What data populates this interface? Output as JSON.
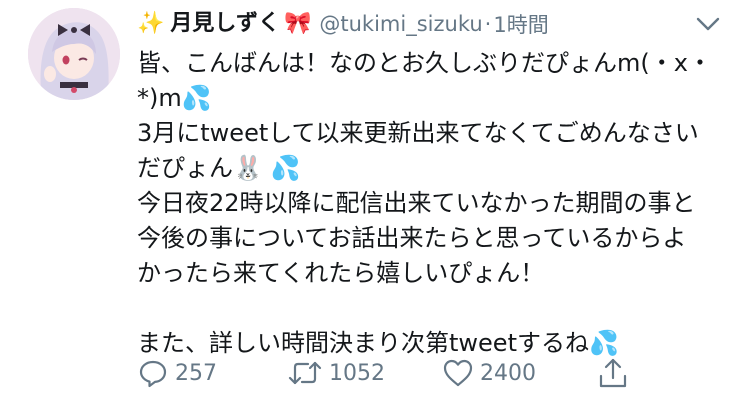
{
  "author": {
    "name_prefix": "✨",
    "name": "月見しずく",
    "name_suffix": "🎀",
    "handle": "@tukimi_sizuku",
    "separator": "·",
    "time": "1時間"
  },
  "tweet": {
    "lines": [
      "皆、こんばんは！なのとお久しぶりだぴょんm(・x・",
      "*)m💦",
      "3月にtweetして以来更新出来てなくてごめんなさい",
      "だぴょん🐰 💦",
      "今日夜22時以降に配信出来ていなかった期間の事と",
      "今後の事についてお話出来たらと思っているからよ",
      "かったら来てくれたら嬉しいぴょん！",
      "",
      "また、詳しい時間決まり次第tweetするね💦"
    ]
  },
  "actions": {
    "replies": "257",
    "retweets": "1052",
    "likes": "2400"
  },
  "colors": {
    "text": "#14171a",
    "secondary": "#657786"
  },
  "icons": [
    "avatar-image",
    "more-caret-icon",
    "reply-icon",
    "retweet-icon",
    "like-icon",
    "share-icon"
  ]
}
